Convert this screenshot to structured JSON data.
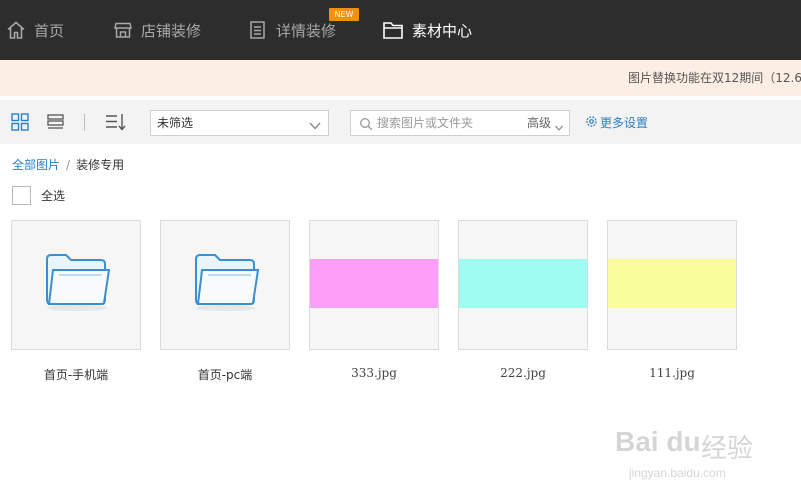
{
  "nav": {
    "items": [
      {
        "label": "首页",
        "icon": "home-icon"
      },
      {
        "label": "店铺装修",
        "icon": "store-icon"
      },
      {
        "label": "详情装修",
        "icon": "document-icon",
        "badge": "NEW"
      },
      {
        "label": "素材中心",
        "icon": "folder-icon",
        "active": true
      }
    ]
  },
  "notice": {
    "text": "图片替换功能在双12期间（12.6~"
  },
  "toolbar": {
    "filter": {
      "value": "未筛选"
    },
    "search": {
      "placeholder": "搜索图片或文件夹",
      "advanced_label": "高级"
    },
    "more_settings_label": "更多设置"
  },
  "breadcrumb": {
    "root": "全部图片",
    "separator": "/",
    "current": "装修专用"
  },
  "select_all_label": "全选",
  "tiles": [
    {
      "type": "folder",
      "name": "首页-手机端"
    },
    {
      "type": "folder",
      "name": "首页-pc端"
    },
    {
      "type": "image",
      "name": "333.jpg",
      "color": "#ff9ef7"
    },
    {
      "type": "image",
      "name": "222.jpg",
      "color": "#9efcf0"
    },
    {
      "type": "image",
      "name": "111.jpg",
      "color": "#f8fc9a"
    }
  ],
  "watermark": {
    "brand": "Bai du",
    "product": "经验",
    "url": "jingyan.baidu.com"
  },
  "colors": {
    "nav_bg": "#2d2d2d",
    "accent": "#2a7fc7",
    "badge": "#f5900b",
    "notice_bg": "#fdeee4"
  }
}
